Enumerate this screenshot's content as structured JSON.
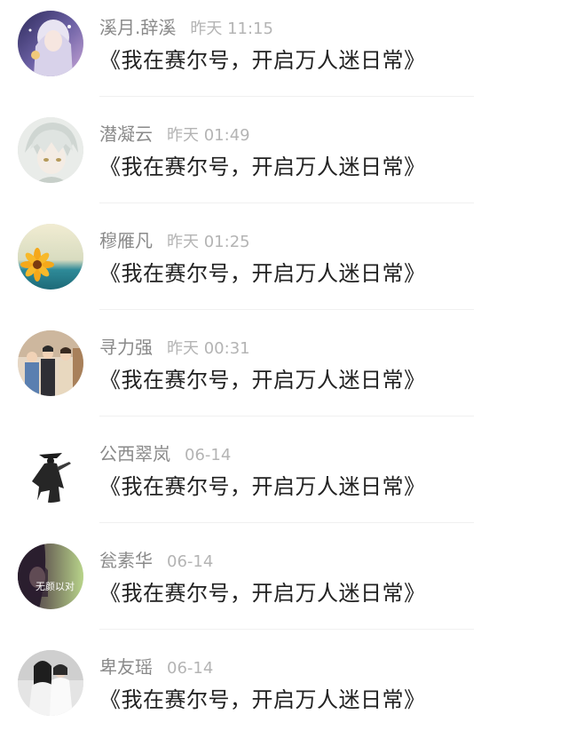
{
  "messages": [
    {
      "name": "溪月.辞溪",
      "time": "昨天 11:15",
      "text": "《我在赛尔号，开启万人迷日常》",
      "avatar": "anime-girl-avatar"
    },
    {
      "name": "潜凝云",
      "time": "昨天 01:49",
      "text": "《我在赛尔号，开启万人迷日常》",
      "avatar": "silver-hair-boy-avatar"
    },
    {
      "name": "穆雁凡",
      "time": "昨天 01:25",
      "text": "《我在赛尔号，开启万人迷日常》",
      "avatar": "sunflower-avatar"
    },
    {
      "name": "寻力强",
      "time": "昨天 00:31",
      "text": "《我在赛尔号，开启万人迷日常》",
      "avatar": "group-photo-avatar"
    },
    {
      "name": "公西翠岚",
      "time": "06-14",
      "text": "《我在赛尔号，开启万人迷日常》",
      "avatar": "cloaked-figure-avatar"
    },
    {
      "name": "瓮素华",
      "time": "06-14",
      "text": "《我在赛尔号，开启万人迷日常》",
      "avatar": "portrait-caption-avatar",
      "avatar_caption": "无颜以对"
    },
    {
      "name": "卑友瑶",
      "time": "06-14",
      "text": "《我在赛尔号，开启万人迷日常》",
      "avatar": "couple-photo-avatar"
    }
  ]
}
